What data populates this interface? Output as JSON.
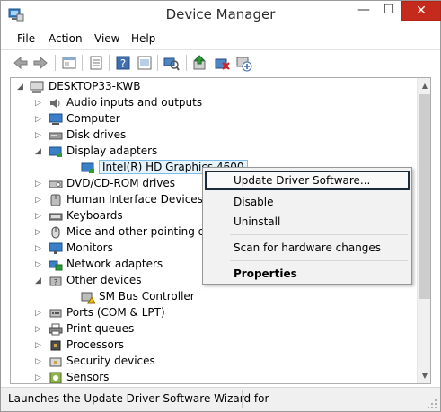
{
  "window": {
    "title": "Device Manager"
  },
  "titlebar": {
    "minimize_glyph": "—",
    "maximize_glyph": "☐",
    "close_glyph": "✕"
  },
  "menu": [
    "File",
    "Action",
    "View",
    "Help"
  ],
  "toolbar": {
    "icons": [
      "back-arrow-icon",
      "forward-arrow-icon",
      "properties-window-icon",
      "device-list-icon",
      "help-icon",
      "show-hidden-icon",
      "scan-hardware-icon",
      "update-driver-icon",
      "uninstall-icon",
      "enable-device-icon"
    ]
  },
  "tree": {
    "root": "DESKTOP33-KWB",
    "items": [
      {
        "label": "Audio inputs and outputs",
        "icon": "speaker-icon",
        "state": "collapsed",
        "level": 1
      },
      {
        "label": "Computer",
        "icon": "computer-icon",
        "state": "collapsed",
        "level": 1
      },
      {
        "label": "Disk drives",
        "icon": "disk-drive-icon",
        "state": "collapsed",
        "level": 1
      },
      {
        "label": "Display adapters",
        "icon": "display-adapter-icon",
        "state": "expanded",
        "level": 1
      },
      {
        "label": "Intel(R) HD Graphics 4600",
        "icon": "display-adapter-icon",
        "state": "leaf",
        "level": 2,
        "selected": true
      },
      {
        "label": "DVD/CD-ROM drives",
        "icon": "dvd-drive-icon",
        "state": "collapsed",
        "level": 1
      },
      {
        "label": "Human Interface Devices",
        "icon": "hid-icon",
        "state": "collapsed",
        "level": 1
      },
      {
        "label": "Keyboards",
        "icon": "keyboard-icon",
        "state": "collapsed",
        "level": 1
      },
      {
        "label": "Mice and other pointing dev",
        "icon": "mouse-icon",
        "state": "collapsed",
        "level": 1
      },
      {
        "label": "Monitors",
        "icon": "monitor-icon",
        "state": "collapsed",
        "level": 1
      },
      {
        "label": "Network adapters",
        "icon": "network-adapter-icon",
        "state": "collapsed",
        "level": 1
      },
      {
        "label": "Other devices",
        "icon": "other-device-icon",
        "state": "expanded",
        "level": 1
      },
      {
        "label": "SM Bus Controller",
        "icon": "unknown-device-warning-icon",
        "state": "leaf",
        "level": 2
      },
      {
        "label": "Ports (COM & LPT)",
        "icon": "port-icon",
        "state": "collapsed",
        "level": 1
      },
      {
        "label": "Print queues",
        "icon": "printer-icon",
        "state": "collapsed",
        "level": 1
      },
      {
        "label": "Processors",
        "icon": "processor-icon",
        "state": "collapsed",
        "level": 1
      },
      {
        "label": "Security devices",
        "icon": "security-device-icon",
        "state": "collapsed",
        "level": 1
      },
      {
        "label": "Sensors",
        "icon": "sensor-icon",
        "state": "collapsed",
        "level": 1
      }
    ]
  },
  "context_menu": {
    "update_driver": "Update Driver Software...",
    "disable": "Disable",
    "uninstall": "Uninstall",
    "scan": "Scan for hardware changes",
    "properties": "Properties"
  },
  "status": {
    "text": "Launches the Update Driver Software Wizard for"
  },
  "colors": {
    "close": "#c42b1c",
    "selection": "#e5f3fb",
    "selection_border": "#7dbde8"
  }
}
